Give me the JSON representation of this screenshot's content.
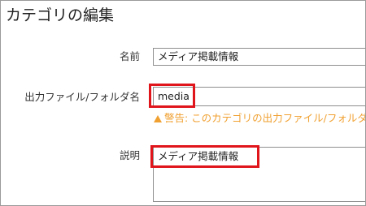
{
  "page": {
    "title": "カテゴリの編集"
  },
  "form": {
    "name": {
      "label": "名前",
      "value": "メディア掲載情報"
    },
    "output": {
      "label": "出力ファイル/フォルダ名",
      "value": "media",
      "warning": "警告: このカテゴリの出力ファイル/フォルダ名"
    },
    "description": {
      "label": "説明",
      "value": "メディア掲載情報"
    }
  },
  "colors": {
    "highlight": "#e0141b",
    "warning": "#f0a030",
    "input_border": "#8e8e8e"
  },
  "icons": {
    "warning": "warning-triangle-icon"
  }
}
